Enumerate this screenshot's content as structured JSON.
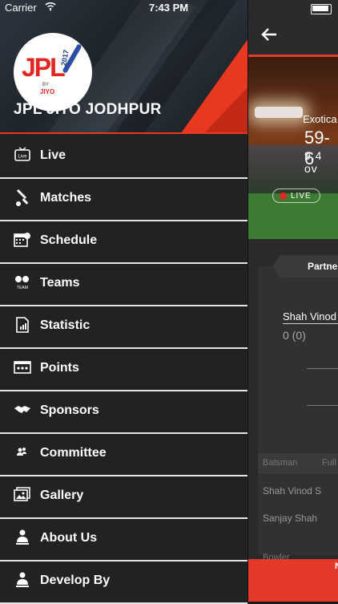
{
  "status_bar": {
    "carrier": "Carrier",
    "time": "7:43 PM"
  },
  "drawer": {
    "app_name": "JPL JITO JODHPUR",
    "logo": {
      "text": "JPL",
      "year": "2017",
      "by": "BY",
      "sponsor": "JIYO"
    },
    "menu": [
      {
        "label": "Live",
        "icon": "tv-icon"
      },
      {
        "label": "Matches",
        "icon": "cricket-bat-icon"
      },
      {
        "label": "Schedule",
        "icon": "calendar-icon"
      },
      {
        "label": "Teams",
        "icon": "team-icon"
      },
      {
        "label": "Statistic",
        "icon": "statistic-icon"
      },
      {
        "label": "Points",
        "icon": "scoreboard-icon"
      },
      {
        "label": "Sponsors",
        "icon": "handshake-icon"
      },
      {
        "label": "Committee",
        "icon": "committee-icon"
      },
      {
        "label": "Gallery",
        "icon": "gallery-icon"
      },
      {
        "label": "About Us",
        "icon": "person-icon"
      },
      {
        "label": "Develop By",
        "icon": "developer-icon"
      }
    ]
  },
  "main": {
    "hero": {
      "team": "Exotica",
      "score": "59-6",
      "overs": "9.4 ov",
      "live_label": "LIVE"
    },
    "tab": "Partne",
    "batsman1": {
      "name": "Shah Vinod",
      "score": "0 (0)"
    },
    "table": {
      "headers": [
        "Batsman",
        "Full"
      ],
      "rows": [
        "Shah Vinod S",
        "Sanjay Shah"
      ],
      "next_header": "Bowler"
    },
    "bottom_button": "N"
  },
  "colors": {
    "accent": "#e8381f",
    "drawer_bg": "#222224",
    "divider": "#e6e6e6"
  }
}
